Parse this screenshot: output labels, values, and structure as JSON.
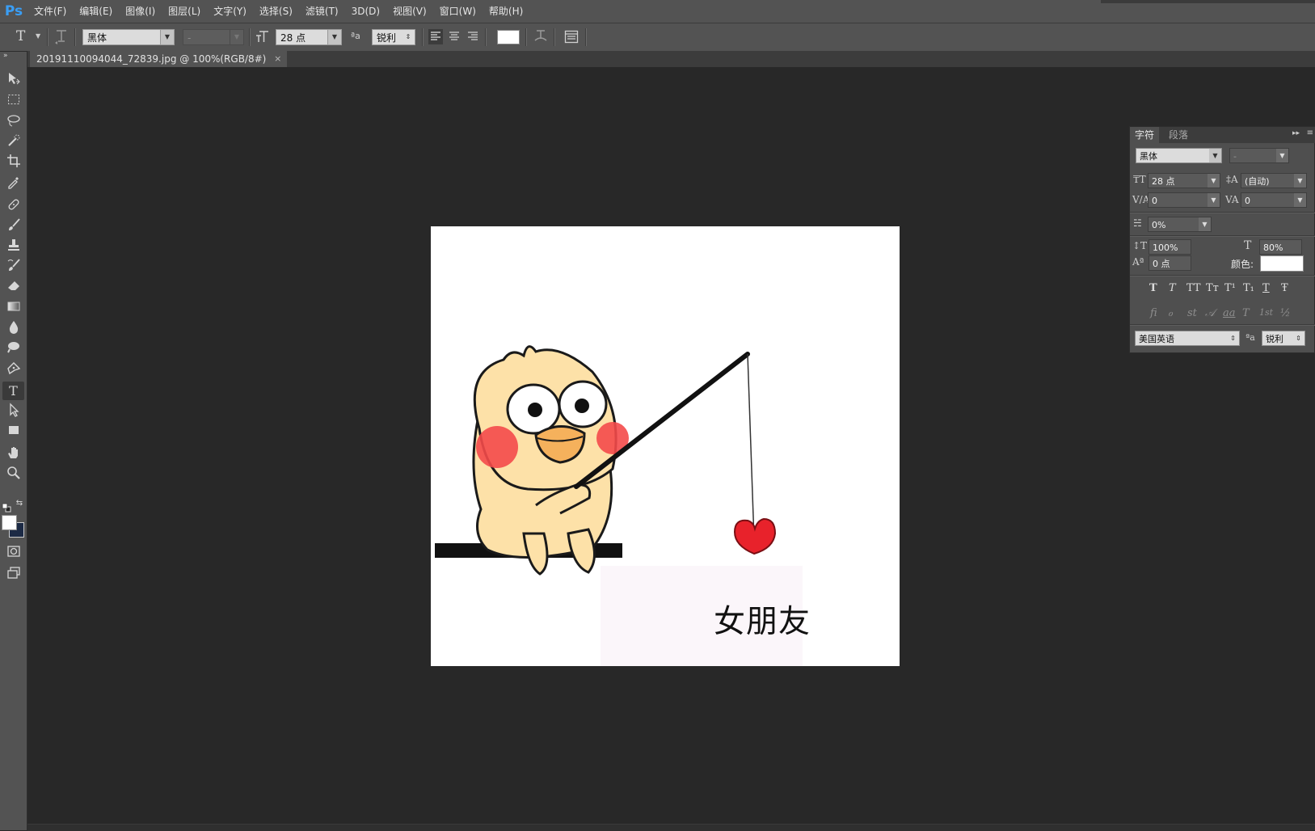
{
  "app": {
    "logo": "Ps"
  },
  "menu": [
    "文件(F)",
    "编辑(E)",
    "图像(I)",
    "图层(L)",
    "文字(Y)",
    "选择(S)",
    "滤镜(T)",
    "3D(D)",
    "视图(V)",
    "窗口(W)",
    "帮助(H)"
  ],
  "options": {
    "tool_icon": "T",
    "font_family": "黑体",
    "font_style": "-",
    "font_size": "28 点",
    "aa_icon": "ªa",
    "anti_alias": "锐利",
    "text_color": "#ffffff"
  },
  "document": {
    "tab_title": "20191110094044_72839.jpg @ 100%(RGB/8#)",
    "close": "×",
    "canvas_text": "女朋友"
  },
  "toolbar": {
    "tools": [
      "move-icon",
      "marquee-icon",
      "lasso-icon",
      "quick-select-icon",
      "crop-icon",
      "eyedropper-icon",
      "healing-brush-icon",
      "brush-icon",
      "clone-stamp-icon",
      "history-brush-icon",
      "eraser-icon",
      "gradient-icon",
      "blur-icon",
      "dodge-icon",
      "pen-icon",
      "type-icon",
      "path-select-icon",
      "rectangle-icon",
      "hand-icon",
      "zoom-icon"
    ],
    "active": "type-icon",
    "foreground_color": "#ffffff",
    "background_color": "#1c2a45"
  },
  "character_panel": {
    "tabs": [
      "字符",
      "段落"
    ],
    "font_family": "黑体",
    "font_style": "-",
    "font_size": "28 点",
    "leading": "(自动)",
    "kerning": "0",
    "tracking": "0",
    "tsume": "0%",
    "vertical_scale": "100%",
    "horizontal_scale": "80%",
    "baseline_shift": "0 点",
    "color_label": "颜色:",
    "color": "#ffffff",
    "style_buttons": [
      "T",
      "T",
      "TT",
      "Tт",
      "T¹",
      "T₁",
      "T",
      "Ŧ"
    ],
    "opentype_buttons": [
      "fi",
      "ℴ",
      "st",
      "𝒜",
      "aa",
      "T",
      "1st",
      "½"
    ],
    "language": "美国英语",
    "aa_icon": "ªa",
    "anti_alias": "锐利"
  }
}
